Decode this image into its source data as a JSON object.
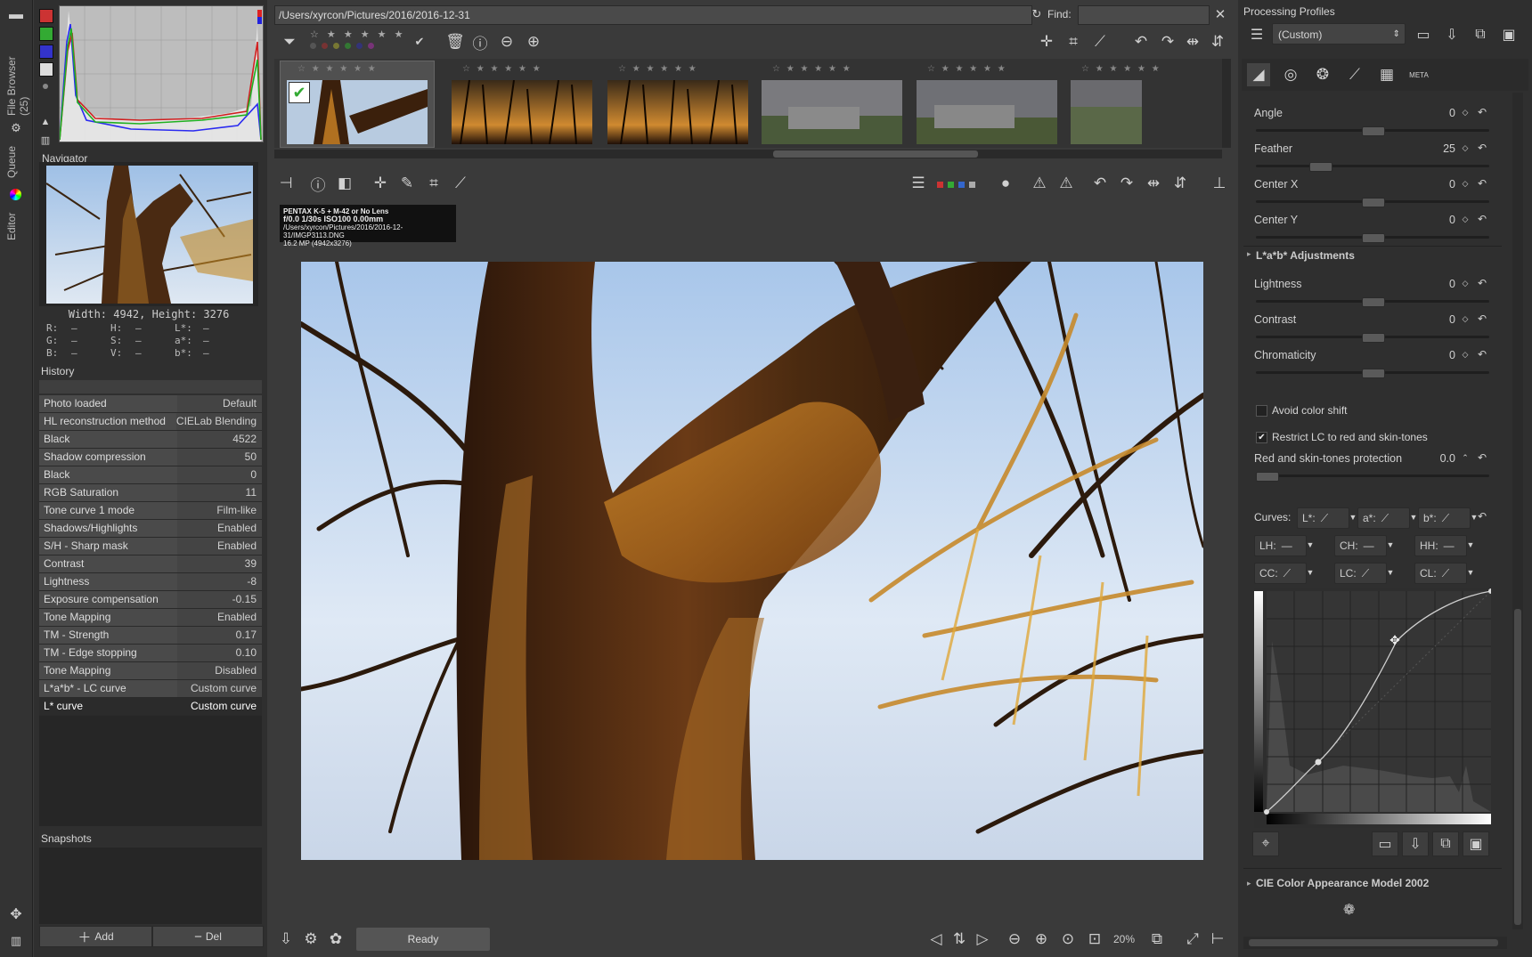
{
  "left_tabs": {
    "file_browser": "File Browser (25)",
    "queue": "Queue",
    "editor": "Editor"
  },
  "navigator": {
    "title": "Navigator",
    "size_text": "Width: 4942, Height: 3276",
    "readouts": [
      [
        "R:",
        "—",
        "H:",
        "—",
        "L*:",
        "—"
      ],
      [
        "G:",
        "—",
        "S:",
        "—",
        "a*:",
        "—"
      ],
      [
        "B:",
        "—",
        "V:",
        "—",
        "b*:",
        "—"
      ]
    ]
  },
  "history": {
    "title": "History",
    "rows": [
      [
        "Photo loaded",
        "Default"
      ],
      [
        "HL reconstruction method",
        "CIELab Blending"
      ],
      [
        "Black",
        "4522"
      ],
      [
        "Shadow compression",
        "50"
      ],
      [
        "Black",
        "0"
      ],
      [
        "RGB Saturation",
        "11"
      ],
      [
        "Tone curve 1 mode",
        "Film-like"
      ],
      [
        "Shadows/Highlights",
        "Enabled"
      ],
      [
        "S/H - Sharp mask",
        "Enabled"
      ],
      [
        "Contrast",
        "39"
      ],
      [
        "Lightness",
        "-8"
      ],
      [
        "Exposure compensation",
        "-0.15"
      ],
      [
        "Tone Mapping",
        "Enabled"
      ],
      [
        "TM - Strength",
        "0.17"
      ],
      [
        "TM - Edge stopping",
        "0.10"
      ],
      [
        "Tone Mapping",
        "Disabled"
      ],
      [
        "L*a*b* - LC curve",
        "Custom curve"
      ],
      [
        "L* curve",
        "Custom curve"
      ]
    ]
  },
  "snapshots": {
    "title": "Snapshots",
    "add": "Add",
    "del": "Del"
  },
  "path": "/Users/xyrcon/Pictures/2016/2016-12-31",
  "find_label": "Find:",
  "find_value": "",
  "exif": {
    "line1": "PENTAX K-5 + M-42 or No Lens",
    "line2": "f/0.0  1/30s  ISO100  0.00mm",
    "line3": "/Users/xyrcon/Pictures/2016/2016-12-31/IMGP3113.DNG",
    "line4": "16.2 MP (4942x3276)"
  },
  "status": "Ready",
  "zoom": "20%",
  "right": {
    "profiles_title": "Processing Profiles",
    "profile_value": "(Custom)",
    "vignette": [
      {
        "label": "Angle",
        "value": "0",
        "pos": 0.5
      },
      {
        "label": "Feather",
        "value": "25",
        "pos": 0.25
      },
      {
        "label": "Center X",
        "value": "0",
        "pos": 0.5
      },
      {
        "label": "Center Y",
        "value": "0",
        "pos": 0.5
      }
    ],
    "lab_title": "L*a*b* Adjustments",
    "lab": [
      {
        "label": "Lightness",
        "value": "0",
        "pos": 0.5
      },
      {
        "label": "Contrast",
        "value": "0",
        "pos": 0.5
      },
      {
        "label": "Chromaticity",
        "value": "0",
        "pos": 0.5
      }
    ],
    "avoid_shift": "Avoid color shift",
    "restrict_lc": "Restrict LC to red and skin-tones",
    "protection_label": "Red and skin-tones protection",
    "protection_value": "0.0",
    "curves_label": "Curves:",
    "curve_buttons": [
      "L*:",
      "a*:",
      "b*:",
      "LH:",
      "CH:",
      "HH:",
      "CC:",
      "LC:",
      "CL:"
    ],
    "ciecam_title": "CIE Color Appearance Model 2002"
  },
  "colors": {
    "accent": "#7fbf3f",
    "bg": "#3a3a3a"
  }
}
